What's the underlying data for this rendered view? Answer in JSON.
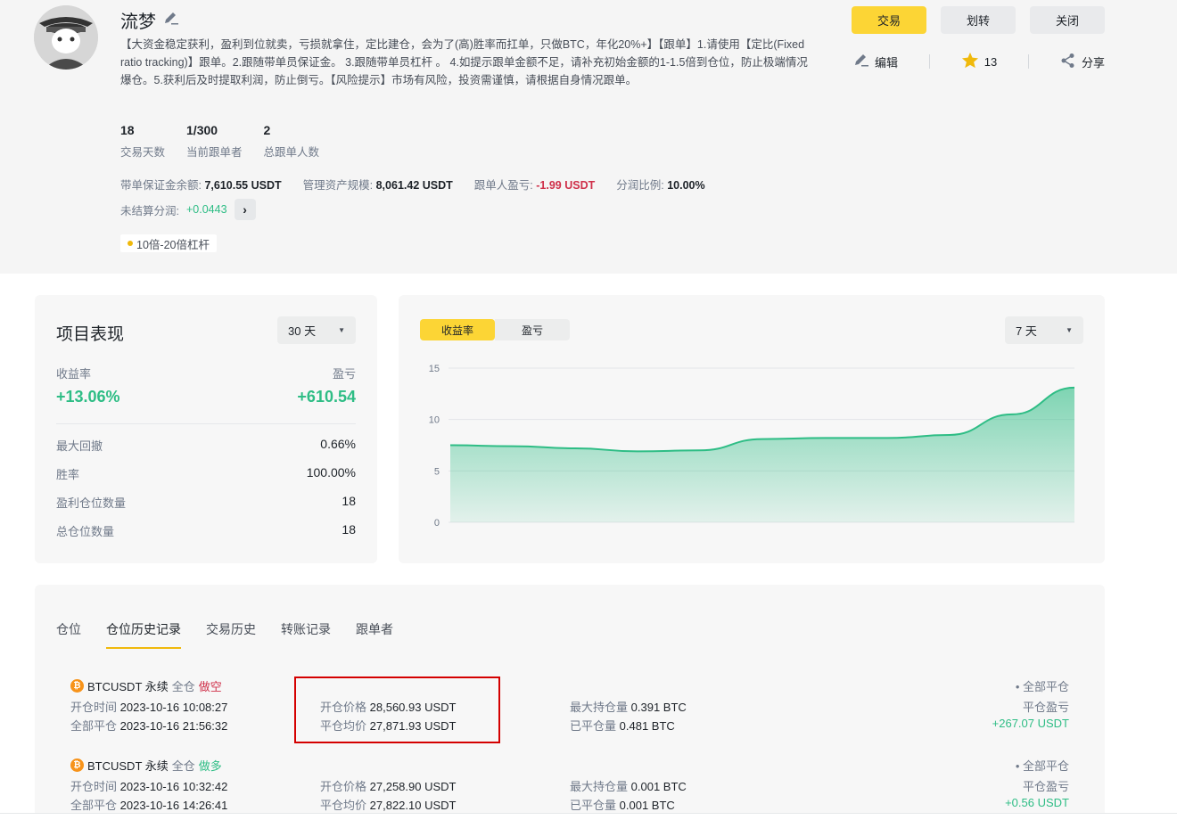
{
  "profile": {
    "name": "流梦",
    "description": "【大资金稳定获利，盈利到位就卖，亏损就拿住，定比建仓，会为了(高)胜率而扛单，只做BTC，年化20%+】【跟单】1.请使用【定比(Fixed ratio tracking)】跟单。2.跟随带单员保证金。 3.跟随带单员杠杆 。 4.如提示跟单金额不足，请补充初始金额的1-1.5倍到仓位，防止极端情况爆仓。5.获利后及时提取利润，防止倒亏。【风险提示】市场有风险，投资需谨慎，请根据自身情况跟单。",
    "stats": [
      {
        "value": "18",
        "label": "交易天数"
      },
      {
        "value": "1/300",
        "label": "当前跟单者"
      },
      {
        "value": "2",
        "label": "总跟单人数"
      }
    ],
    "metrics": {
      "margin_label": "带单保证金余额:",
      "margin_value": "7,610.55 USDT",
      "aum_label": "管理资产规模:",
      "aum_value": "8,061.42 USDT",
      "follower_pnl_label": "跟单人盈亏:",
      "follower_pnl_value": "-1.99 USDT",
      "share_label": "分润比例:",
      "share_value": "10.00%",
      "unsettled_label": "未结算分润:",
      "unsettled_value": "+0.0443"
    },
    "tag": "10倍-20倍杠杆"
  },
  "header_buttons": {
    "trade": "交易",
    "transfer": "划转",
    "close": "关闭"
  },
  "header_actions": {
    "edit": "编辑",
    "stars": "13",
    "share": "分享"
  },
  "performance": {
    "title": "项目表现",
    "period": "30 天",
    "roi_label": "收益率",
    "roi_value": "+13.06%",
    "pnl_label": "盈亏",
    "pnl_value": "+610.54",
    "rows": [
      {
        "label": "最大回撤",
        "value": "0.66%"
      },
      {
        "label": "胜率",
        "value": "100.00%"
      },
      {
        "label": "盈利仓位数量",
        "value": "18"
      },
      {
        "label": "总仓位数量",
        "value": "18"
      }
    ]
  },
  "chart_panel": {
    "tab_active": "收益率",
    "tab_inactive": "盈亏",
    "period": "7 天",
    "y_ticks": [
      "15",
      "10",
      "5",
      "0"
    ]
  },
  "chart_data": {
    "type": "area",
    "title": "",
    "xlabel": "",
    "ylabel": "",
    "ylim": [
      0,
      15
    ],
    "x": [
      1,
      2,
      3,
      4,
      5,
      6,
      7,
      8,
      9,
      10,
      11
    ],
    "series": [
      {
        "values": [
          7.5,
          7.4,
          7.2,
          6.9,
          7.0,
          8.1,
          8.2,
          8.2,
          8.5,
          10.5,
          13.1
        ]
      }
    ],
    "grid": true,
    "color": "#2ebd85"
  },
  "history": {
    "tabs": [
      "仓位",
      "仓位历史记录",
      "交易历史",
      "转账记录",
      "跟单者"
    ],
    "active_tab": 1,
    "positions": [
      {
        "symbol": "BTCUSDT 永续",
        "margin_mode": "全仓",
        "side": "做空",
        "side_color": "#cf304a",
        "open_time_label": "开仓时间",
        "open_time": "2023-10-16 10:08:27",
        "close_time_label": "全部平仓",
        "close_time": "2023-10-16 21:56:32",
        "open_price_label": "开仓价格",
        "open_price": "28,560.93 USDT",
        "close_price_label": "平仓均价",
        "close_price": "27,871.93 USDT",
        "max_qty_label": "最大持仓量",
        "max_qty": "0.391 BTC",
        "closed_qty_label": "已平仓量",
        "closed_qty": "0.481 BTC",
        "status": "• 全部平仓",
        "pnl_label": "平仓盈亏",
        "pnl": "+267.07 USDT"
      },
      {
        "symbol": "BTCUSDT 永续",
        "margin_mode": "全仓",
        "side": "做多",
        "side_color": "#2ebd85",
        "open_time_label": "开仓时间",
        "open_time": "2023-10-16 10:32:42",
        "close_time_label": "全部平仓",
        "close_time": "2023-10-16 14:26:41",
        "open_price_label": "开仓价格",
        "open_price": "27,258.90 USDT",
        "close_price_label": "平仓均价",
        "close_price": "27,822.10 USDT",
        "max_qty_label": "最大持仓量",
        "max_qty": "0.001 BTC",
        "closed_qty_label": "已平仓量",
        "closed_qty": "0.001 BTC",
        "status": "• 全部平仓",
        "pnl_label": "平仓盈亏",
        "pnl": "+0.56 USDT"
      }
    ]
  },
  "colors": {
    "accent": "#fcd535",
    "positive": "#2ebd85",
    "negative": "#cf304a",
    "highlight_box": "#d40000"
  }
}
